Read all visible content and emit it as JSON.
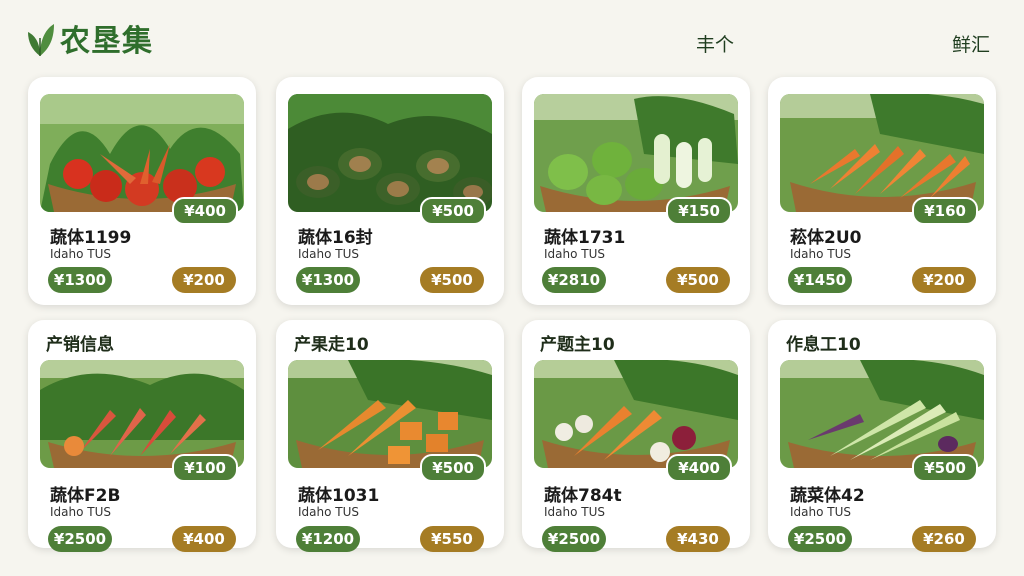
{
  "header": {
    "logo_text": "农垦集",
    "nav": [
      "丰个",
      "鲜汇"
    ]
  },
  "products": [
    {
      "heading": "",
      "title": "蔬体1199",
      "sub": "Idaho TUS",
      "img_price": "¥400",
      "green_price": "¥1300",
      "gold_price": "¥200",
      "image": "tomatoes-and-carrots"
    },
    {
      "heading": "",
      "title": "蔬体16封",
      "sub": "Idaho TUS",
      "img_price": "¥500",
      "green_price": "¥1300",
      "gold_price": "¥500",
      "image": "avocados"
    },
    {
      "heading": "",
      "title": "蔬体1731",
      "sub": "Idaho TUS",
      "img_price": "¥150",
      "green_price": "¥2810",
      "gold_price": "¥500",
      "image": "green-peppers-bok-choy"
    },
    {
      "heading": "",
      "title": "菘体2U0",
      "sub": "Idaho TUS",
      "img_price": "¥160",
      "green_price": "¥1450",
      "gold_price": "¥200",
      "image": "carrots"
    },
    {
      "heading": "产销信息",
      "title": "蔬体F2B",
      "sub": "Idaho TUS",
      "img_price": "¥100",
      "green_price": "¥2500",
      "gold_price": "¥400",
      "image": "carrots-and-greens"
    },
    {
      "heading": "产果走10",
      "title": "蔬体1031",
      "sub": "Idaho TUS",
      "img_price": "¥500",
      "green_price": "¥1200",
      "gold_price": "¥550",
      "image": "squash-and-carrots"
    },
    {
      "heading": "产题主10",
      "title": "蔬体784t",
      "sub": "Idaho TUS",
      "img_price": "¥400",
      "green_price": "¥2500",
      "gold_price": "¥430",
      "image": "carrots-and-radishes"
    },
    {
      "heading": "作息工10",
      "title": "蔬菜体42",
      "sub": "Idaho TUS",
      "img_price": "¥500",
      "green_price": "¥2500",
      "gold_price": "¥260",
      "image": "leeks-and-eggplant"
    }
  ],
  "colors": {
    "brand_green": "#2f6e2c",
    "price_green": "#4e7f38",
    "price_gold": "#a57c24"
  }
}
